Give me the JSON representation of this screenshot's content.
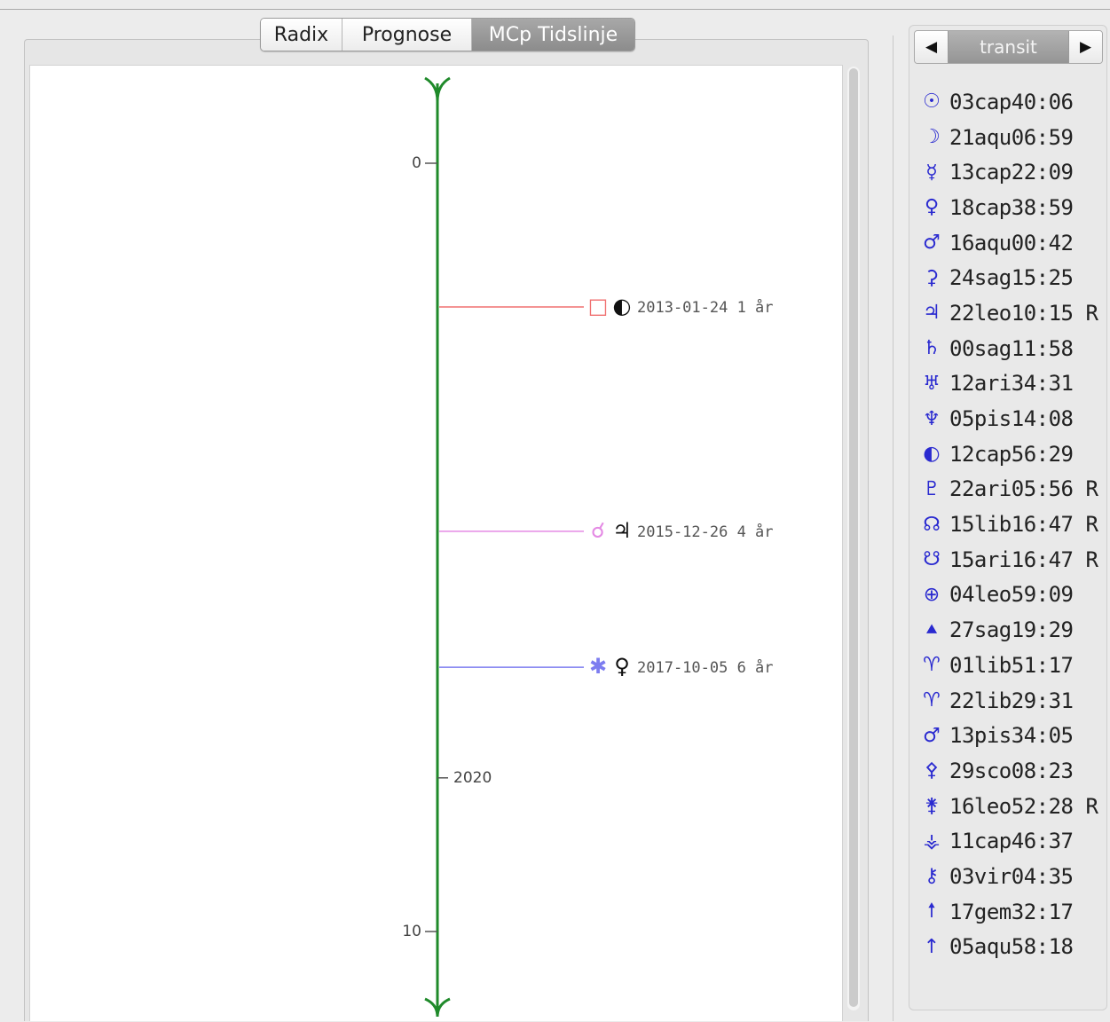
{
  "tabs": [
    {
      "label": "Radix",
      "active": false
    },
    {
      "label": "Prognose",
      "active": false
    },
    {
      "label": "MCp Tidslinje",
      "active": true
    }
  ],
  "timeline": {
    "top_glyph": "♈",
    "bottom_glyph": "♈",
    "ticks": [
      {
        "label": "0",
        "age": 0,
        "side": "left"
      },
      {
        "label": "2020",
        "age": 8,
        "side": "right"
      },
      {
        "label": "10",
        "age": 10,
        "side": "left"
      }
    ],
    "events": [
      {
        "age": 1.87,
        "color": "#f07070",
        "aspect_glyph": "□",
        "planet_glyph": "◐",
        "label": "2013-01-24 1 år"
      },
      {
        "age": 4.79,
        "color": "#e48ae4",
        "aspect_glyph": "☌",
        "planet_glyph": "♃",
        "label": "2015-12-26 4 år"
      },
      {
        "age": 6.56,
        "color": "#7d7df0",
        "aspect_glyph": "✱",
        "planet_glyph": "♀",
        "label": "2017-10-05 6 år"
      }
    ]
  },
  "transit_panel": {
    "prev_label": "◀",
    "title": "transit",
    "next_label": "▶",
    "accent_color": "#2a2ad0",
    "positions": [
      {
        "icon": "sun-icon",
        "glyph": "☉",
        "text": "03cap40:06"
      },
      {
        "icon": "moon-icon",
        "glyph": "☽",
        "text": "21aqu06:59"
      },
      {
        "icon": "mercury-icon",
        "glyph": "☿",
        "text": "13cap22:09"
      },
      {
        "icon": "venus-icon",
        "glyph": "♀",
        "text": "18cap38:59"
      },
      {
        "icon": "mars-icon",
        "glyph": "♂",
        "text": "16aqu00:42"
      },
      {
        "icon": "ceres-icon",
        "glyph": "⚳",
        "text": "24sag15:25"
      },
      {
        "icon": "jupiter-icon",
        "glyph": "♃",
        "text": "22leo10:15 R"
      },
      {
        "icon": "saturn-icon",
        "glyph": "♄",
        "text": "00sag11:58"
      },
      {
        "icon": "uranus-icon",
        "glyph": "♅",
        "text": "12ari34:31"
      },
      {
        "icon": "neptune-icon",
        "glyph": "♆",
        "text": "05pis14:08"
      },
      {
        "icon": "lunation-icon",
        "glyph": "◐",
        "text": "12cap56:29"
      },
      {
        "icon": "pluto-icon",
        "glyph": "♇",
        "text": "22ari05:56 R"
      },
      {
        "icon": "north-node-icon",
        "glyph": "☊",
        "text": "15lib16:47 R"
      },
      {
        "icon": "south-node-icon",
        "glyph": "☋",
        "text": "15ari16:47 R"
      },
      {
        "icon": "earth-icon",
        "glyph": "⊕",
        "text": "04leo59:09"
      },
      {
        "icon": "point-icon",
        "glyph": "⯅",
        "text": "27sag19:29"
      },
      {
        "icon": "point-icon",
        "glyph": "♈",
        "text": "01lib51:17"
      },
      {
        "icon": "point-icon",
        "glyph": "♈",
        "text": "22lib29:31"
      },
      {
        "icon": "point-icon",
        "glyph": "♂",
        "text": "13pis34:05"
      },
      {
        "icon": "point-icon",
        "glyph": "⚴",
        "text": "29sco08:23"
      },
      {
        "icon": "point-icon",
        "glyph": "⚵",
        "text": "16leo52:28 R"
      },
      {
        "icon": "point-icon",
        "glyph": "⚶",
        "text": "11cap46:37"
      },
      {
        "icon": "point-icon",
        "glyph": "⚷",
        "text": "03vir04:35"
      },
      {
        "icon": "arrow-icon",
        "glyph": "🠕",
        "text": "17gem32:17"
      },
      {
        "icon": "arrow-icon",
        "glyph": "↑",
        "text": "05aqu58:18"
      }
    ]
  }
}
